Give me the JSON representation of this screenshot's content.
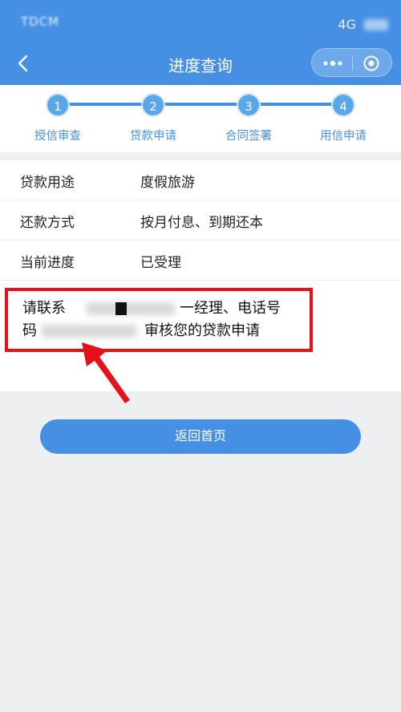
{
  "status_bar": {
    "carrier": "TDCM",
    "network": "4G"
  },
  "nav": {
    "title": "进度查询",
    "back_icon": "chevron-left-icon",
    "more_icon": "more-dots-icon",
    "target_icon": "target-icon"
  },
  "steps": [
    {
      "number": "1",
      "label": "授信审查"
    },
    {
      "number": "2",
      "label": "贷款申请"
    },
    {
      "number": "3",
      "label": "合同签署"
    },
    {
      "number": "4",
      "label": "用信申请"
    }
  ],
  "details": [
    {
      "label": "贷款用途",
      "value": "度假旅游"
    },
    {
      "label": "还款方式",
      "value": "按月付息、到期还本"
    },
    {
      "label": "当前进度",
      "value": "已受理"
    }
  ],
  "message": {
    "line1_start": "请联系",
    "line1_end": "一经理、电话号",
    "line2_start": "码",
    "line2_end": "审核您的贷款申请"
  },
  "return_button": "返回首页",
  "colors": {
    "primary": "#4590e5",
    "highlight": "#e5101a",
    "background": "#eeeff1"
  }
}
